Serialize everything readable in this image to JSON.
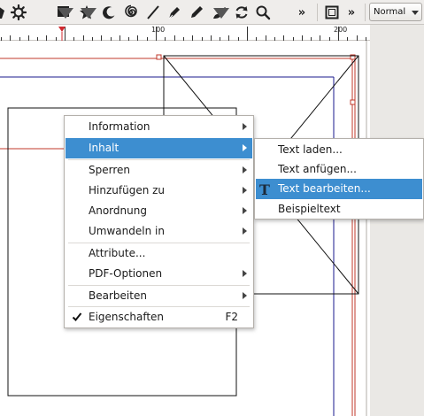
{
  "toolbar": {
    "tools": [
      {
        "icon": "gear-shape-icon"
      },
      {
        "icon": "rectangle-shape-icon"
      },
      {
        "icon": "star-icon"
      },
      {
        "icon": "crescent-icon"
      },
      {
        "icon": "spiral-icon"
      },
      {
        "icon": "line-icon"
      },
      {
        "icon": "pen-icon"
      },
      {
        "icon": "pencil-icon"
      },
      {
        "icon": "calligraphy-brush-icon"
      },
      {
        "icon": "rotate-icon"
      },
      {
        "icon": "zoom-magnifier-icon"
      }
    ],
    "overflow1": "»",
    "overflow2": "»",
    "zoom_mode": "Normal"
  },
  "ruler": {
    "labels": [
      "100",
      "200"
    ]
  },
  "colors": {
    "menu_highlight": "#3d8ed0",
    "frame_red": "#c0392b",
    "margin_blue": "#1a1a8c"
  },
  "context_menu": {
    "items": [
      {
        "label": "Information",
        "submenu": true
      },
      {
        "label": "Inhalt",
        "submenu": true,
        "highlighted": true
      },
      {
        "label": "Sperren",
        "submenu": true
      },
      {
        "label": "Hinzufügen zu",
        "submenu": true
      },
      {
        "label": "Anordnung",
        "submenu": true
      },
      {
        "label": "Umwandeln in",
        "submenu": true
      },
      {
        "label": "Attribute...",
        "submenu": false
      },
      {
        "label": "PDF-Optionen",
        "submenu": true
      },
      {
        "label": "Bearbeiten",
        "submenu": true
      },
      {
        "label": "Eigenschaften",
        "shortcut": "F2",
        "checked": true
      }
    ]
  },
  "submenu": {
    "items": [
      {
        "label": "Text laden..."
      },
      {
        "label": "Text anfügen..."
      },
      {
        "label": "Text bearbeiten...",
        "highlighted": true,
        "icon": "text-edit-icon"
      },
      {
        "label": "Beispieltext"
      }
    ],
    "text_icon_glyph": "T"
  }
}
